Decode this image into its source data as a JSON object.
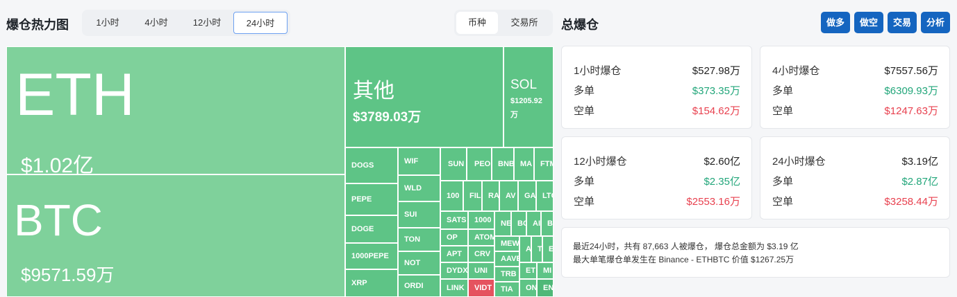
{
  "heatmap": {
    "title": "爆仓热力图",
    "time_tabs": [
      "1小时",
      "4小时",
      "12小时",
      "24小时"
    ],
    "active_time": "24小时",
    "view_tabs": [
      "币种",
      "交易所"
    ],
    "active_view": "币种"
  },
  "treemap": {
    "eth": {
      "symbol": "ETH",
      "value": "$1.02亿"
    },
    "btc": {
      "symbol": "BTC",
      "value": "$9571.59万"
    },
    "other": {
      "symbol": "其他",
      "value": "$3789.03万"
    },
    "sol": {
      "symbol": "SOL",
      "value_line1": "$1205.92",
      "value_line2": "万"
    },
    "small": [
      "DOGS",
      "PEPE",
      "DOGE",
      "1000PEPE",
      "XRP",
      "WIF",
      "WLD",
      "SUI",
      "TON",
      "NOT",
      "ORDI",
      "SUN",
      "PEOP",
      "BNB",
      "MA",
      "FTM",
      "100",
      "FIL",
      "RA",
      "AV",
      "GA",
      "LTC",
      "SATS",
      "1000",
      "OP",
      "ATOM",
      "APT",
      "CRV",
      "DYDX",
      "UNI",
      "LINK",
      "VIDT",
      "NE",
      "BC",
      "AI",
      "BO",
      "MEW",
      "AAVE",
      "TRB",
      "TIA",
      "A",
      "T",
      "E",
      "ET",
      "ON",
      "MI",
      "EN"
    ]
  },
  "liquidation": {
    "title": "总爆仓",
    "buttons": [
      "做多",
      "做空",
      "交易",
      "分析"
    ],
    "cards": [
      {
        "label": "1小时爆仓",
        "total": "$527.98万",
        "long_label": "多单",
        "long": "$373.35万",
        "short_label": "空单",
        "short": "$154.62万"
      },
      {
        "label": "4小时爆仓",
        "total": "$7557.56万",
        "long_label": "多单",
        "long": "$6309.93万",
        "short_label": "空单",
        "short": "$1247.63万"
      },
      {
        "label": "12小时爆仓",
        "total": "$2.60亿",
        "long_label": "多单",
        "long": "$2.35亿",
        "short_label": "空单",
        "short": "$2553.16万"
      },
      {
        "label": "24小时爆仓",
        "total": "$3.19亿",
        "long_label": "多单",
        "long": "$2.87亿",
        "short_label": "空单",
        "short": "$3258.44万"
      }
    ],
    "summary_line1": "最近24小时，共有 87,663 人被爆仓， 爆仓总金额为 $3.19 亿",
    "summary_line2": "最大单笔爆仓单发生在 Binance - ETHBTC 价值 $1267.25万"
  },
  "colors": {
    "accent": "#1565c0",
    "long": "#22a67a",
    "short": "#e8414f",
    "tile": "#5ec486"
  }
}
